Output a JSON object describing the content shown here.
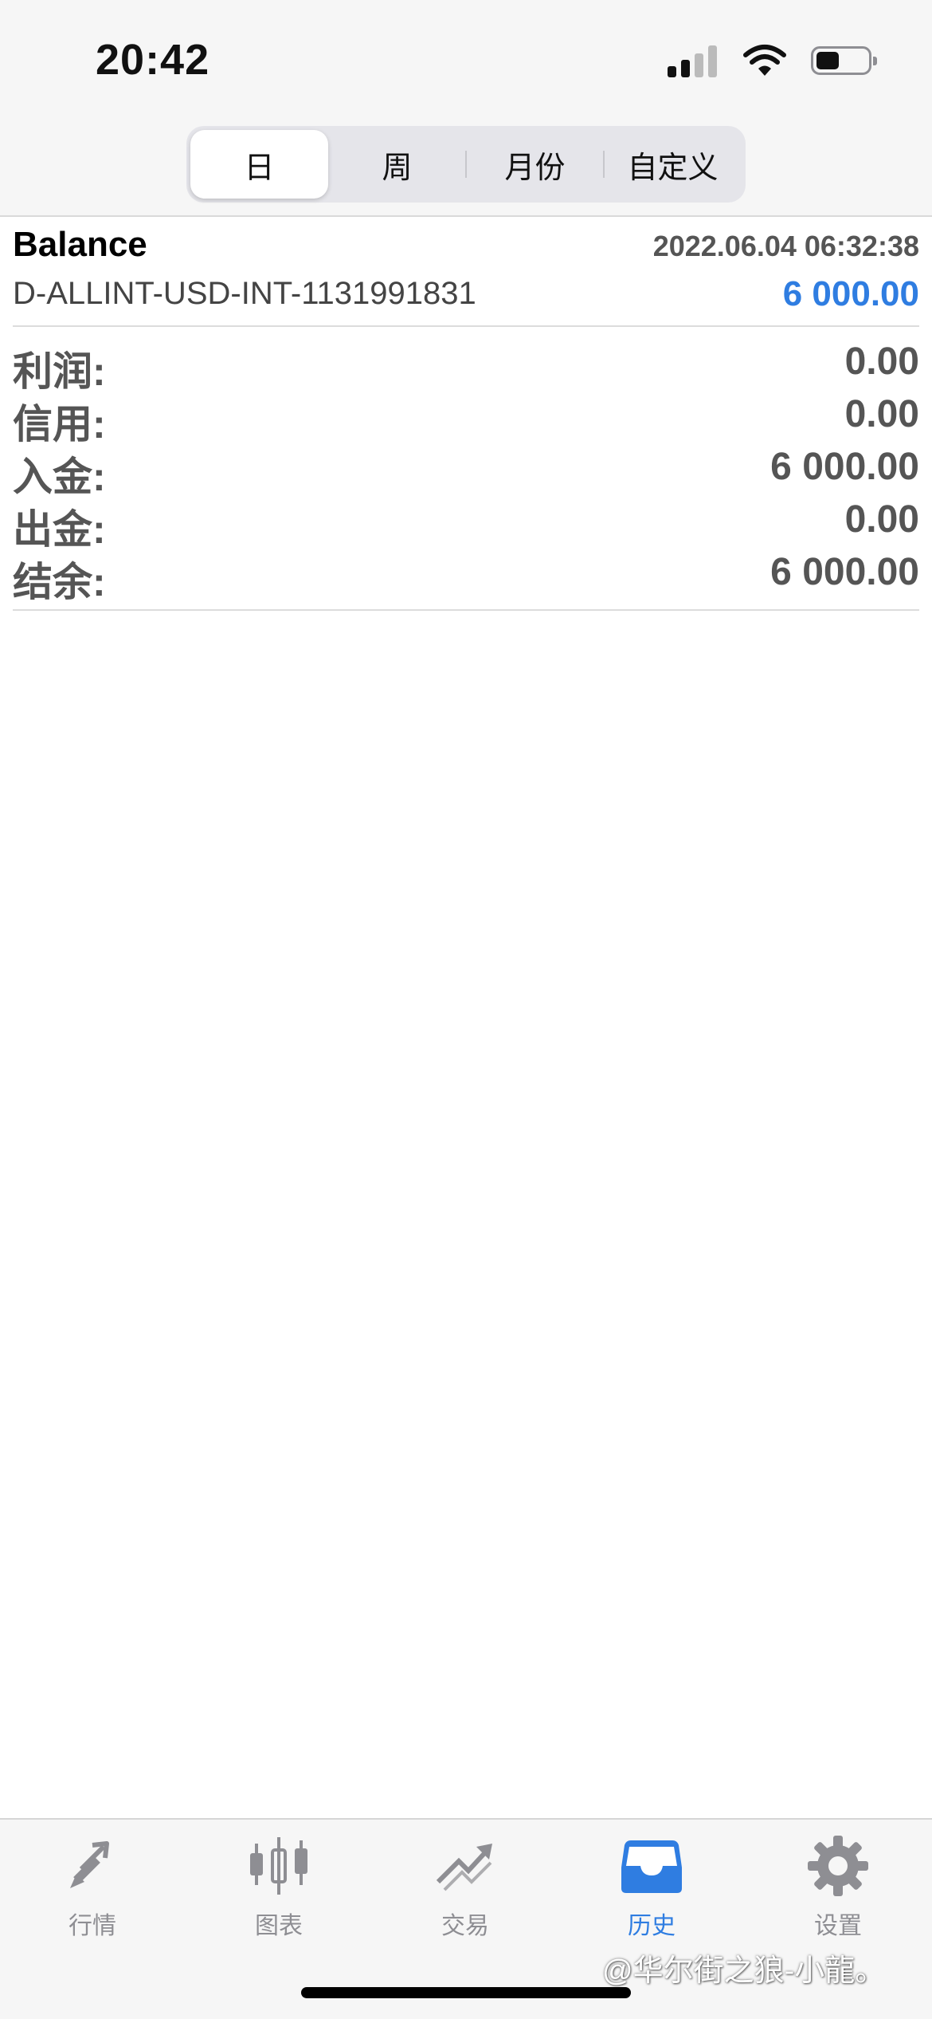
{
  "status_bar": {
    "time": "20:42"
  },
  "period_tabs": [
    {
      "label": "日",
      "active": true
    },
    {
      "label": "周",
      "active": false
    },
    {
      "label": "月份",
      "active": false
    },
    {
      "label": "自定义",
      "active": false
    }
  ],
  "record": {
    "type": "Balance",
    "datetime": "2022.06.04 06:32:38",
    "comment": "D-ALLINT-USD-INT-1131991831",
    "amount": "6 000.00"
  },
  "summary": [
    {
      "label": "利润:",
      "value": "0.00"
    },
    {
      "label": "信用:",
      "value": "0.00"
    },
    {
      "label": "入金:",
      "value": "6 000.00"
    },
    {
      "label": "出金:",
      "value": "0.00"
    },
    {
      "label": "结余:",
      "value": "6 000.00"
    }
  ],
  "tab_bar": [
    {
      "label": "行情",
      "icon": "quotes-arrows-icon",
      "active": false
    },
    {
      "label": "图表",
      "icon": "candlestick-chart-icon",
      "active": false
    },
    {
      "label": "交易",
      "icon": "trade-trend-icon",
      "active": false
    },
    {
      "label": "历史",
      "icon": "history-inbox-icon",
      "active": true
    },
    {
      "label": "设置",
      "icon": "gear-icon",
      "active": false
    }
  ],
  "watermark": "@华尔街之狼-小龍。",
  "colors": {
    "accent": "#2f7de1",
    "tab_inactive": "#8e8e93",
    "header_bg": "#f6f6f6"
  }
}
